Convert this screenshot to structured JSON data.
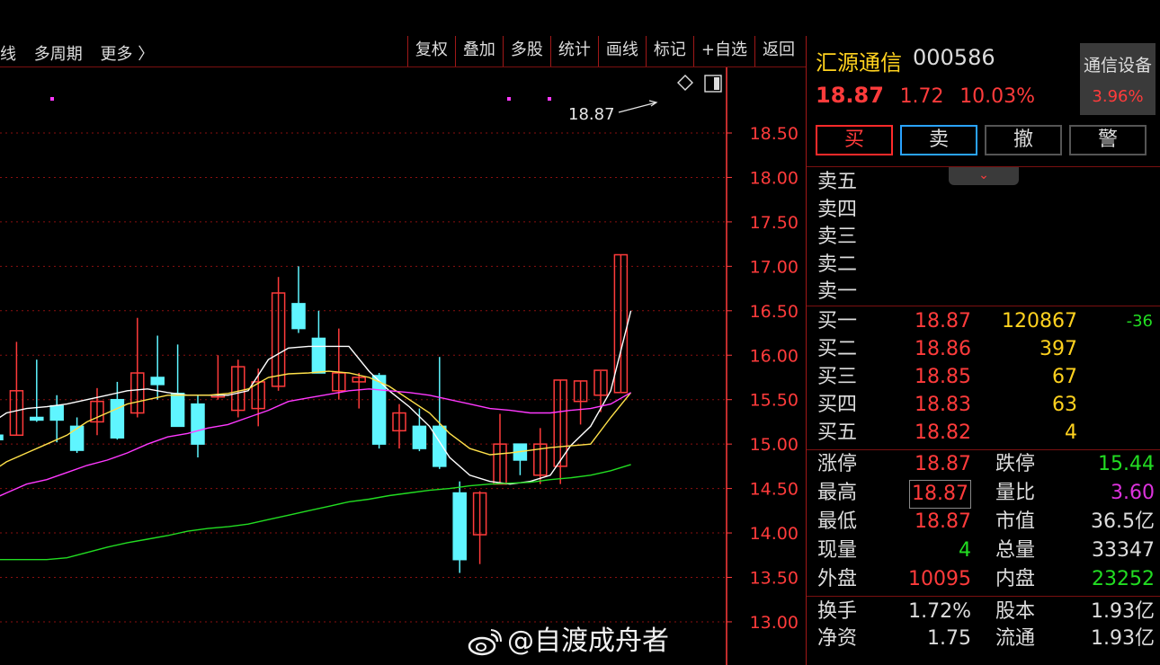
{
  "toolbar": {
    "left_items": [
      "线",
      "多周期",
      "更多 〉"
    ],
    "right_items": [
      "复权",
      "叠加",
      "多股",
      "统计",
      "画线",
      "标记",
      "+自选",
      "返回"
    ]
  },
  "chart_data": {
    "type": "candlestick",
    "y_ticks": [
      "18.50",
      "18.00",
      "17.50",
      "17.00",
      "16.50",
      "16.00",
      "15.50",
      "15.00",
      "14.50",
      "14.00",
      "13.50",
      "13.00"
    ],
    "ylim": [
      12.9,
      18.97
    ],
    "high_label": "18.87",
    "candles": [
      {
        "o": 15.1,
        "h": 15.25,
        "l": 14.8,
        "c": 15.05
      },
      {
        "o": 15.1,
        "h": 16.15,
        "l": 15.1,
        "c": 15.6
      },
      {
        "o": 15.3,
        "h": 15.95,
        "l": 15.25,
        "c": 15.27
      },
      {
        "o": 15.43,
        "h": 15.55,
        "l": 15.02,
        "c": 15.27
      },
      {
        "o": 15.2,
        "h": 15.3,
        "l": 14.9,
        "c": 14.93
      },
      {
        "o": 15.25,
        "h": 15.63,
        "l": 15.1,
        "c": 15.48
      },
      {
        "o": 15.5,
        "h": 15.7,
        "l": 15.05,
        "c": 15.07
      },
      {
        "o": 15.35,
        "h": 16.42,
        "l": 15.3,
        "c": 15.8
      },
      {
        "o": 15.75,
        "h": 16.22,
        "l": 15.5,
        "c": 15.67
      },
      {
        "o": 15.57,
        "h": 16.12,
        "l": 15.35,
        "c": 15.2
      },
      {
        "o": 15.45,
        "h": 15.55,
        "l": 14.85,
        "c": 15.0
      },
      {
        "o": 15.55,
        "h": 16.0,
        "l": 15.5,
        "c": 15.55
      },
      {
        "o": 15.38,
        "h": 15.95,
        "l": 15.3,
        "c": 15.87
      },
      {
        "o": 15.4,
        "h": 15.85,
        "l": 15.2,
        "c": 15.7
      },
      {
        "o": 15.65,
        "h": 16.88,
        "l": 15.6,
        "c": 16.7
      },
      {
        "o": 16.58,
        "h": 17.0,
        "l": 16.25,
        "c": 16.3
      },
      {
        "o": 16.19,
        "h": 16.5,
        "l": 15.8,
        "c": 15.8
      },
      {
        "o": 15.6,
        "h": 16.3,
        "l": 15.5,
        "c": 15.8
      },
      {
        "o": 15.7,
        "h": 15.8,
        "l": 15.4,
        "c": 15.75
      },
      {
        "o": 15.77,
        "h": 15.8,
        "l": 14.95,
        "c": 15.0
      },
      {
        "o": 15.15,
        "h": 15.45,
        "l": 14.95,
        "c": 15.35
      },
      {
        "o": 15.2,
        "h": 15.4,
        "l": 14.92,
        "c": 14.95
      },
      {
        "o": 15.2,
        "h": 15.98,
        "l": 14.72,
        "c": 14.75
      },
      {
        "o": 14.45,
        "h": 14.58,
        "l": 13.55,
        "c": 13.7
      },
      {
        "o": 13.98,
        "h": 14.47,
        "l": 13.65,
        "c": 14.45
      },
      {
        "o": 14.55,
        "h": 15.34,
        "l": 14.55,
        "c": 15.0
      },
      {
        "o": 15.0,
        "h": 15.0,
        "l": 14.65,
        "c": 14.82
      },
      {
        "o": 14.65,
        "h": 15.18,
        "l": 14.55,
        "c": 15.0
      },
      {
        "o": 14.75,
        "h": 15.72,
        "l": 14.55,
        "c": 15.72
      },
      {
        "o": 15.48,
        "h": 15.71,
        "l": 15.22,
        "c": 15.71
      },
      {
        "o": 15.55,
        "h": 15.82,
        "l": 15.36,
        "c": 15.83
      },
      {
        "o": 15.58,
        "h": 17.13,
        "l": 15.58,
        "c": 17.13
      }
    ],
    "ma_lines": [
      {
        "name": "MA5",
        "color": "#ffffff",
        "values": [
          15.2,
          15.35,
          15.4,
          15.42,
          15.45,
          15.5,
          15.55,
          15.6,
          15.62,
          15.58,
          15.55,
          15.55,
          15.55,
          15.6,
          15.95,
          16.08,
          16.1,
          16.1,
          16.1,
          15.82,
          15.6,
          15.42,
          15.2,
          14.85,
          14.65,
          14.58,
          14.55,
          14.58,
          14.65,
          14.98,
          15.2,
          15.6,
          16.5
        ]
      },
      {
        "name": "MA10",
        "color": "#ffe14a",
        "values": [
          14.65,
          14.8,
          14.9,
          15.0,
          15.1,
          15.25,
          15.35,
          15.45,
          15.5,
          15.55,
          15.55,
          15.55,
          15.57,
          15.62,
          15.75,
          15.79,
          15.8,
          15.82,
          15.8,
          15.75,
          15.65,
          15.5,
          15.35,
          15.12,
          14.95,
          14.88,
          14.9,
          14.93,
          14.96,
          14.98,
          15.0,
          15.3,
          15.58
        ]
      },
      {
        "name": "MA20",
        "color": "#ff39ff",
        "values": [
          14.35,
          14.45,
          14.55,
          14.6,
          14.68,
          14.76,
          14.82,
          14.9,
          15.0,
          15.08,
          15.12,
          15.18,
          15.22,
          15.3,
          15.38,
          15.48,
          15.52,
          15.56,
          15.6,
          15.62,
          15.6,
          15.58,
          15.55,
          15.5,
          15.45,
          15.4,
          15.38,
          15.35,
          15.35,
          15.38,
          15.4,
          15.45,
          15.58
        ]
      },
      {
        "name": "MA60",
        "color": "#22dd22",
        "values": [
          13.7,
          13.7,
          13.7,
          13.7,
          13.72,
          13.78,
          13.84,
          13.89,
          13.93,
          13.97,
          14.02,
          14.05,
          14.07,
          14.1,
          14.15,
          14.2,
          14.25,
          14.3,
          14.35,
          14.38,
          14.42,
          14.45,
          14.48,
          14.5,
          14.53,
          14.55,
          14.56,
          14.57,
          14.6,
          14.62,
          14.65,
          14.7,
          14.77
        ]
      }
    ]
  },
  "stock": {
    "name": "汇源通信",
    "code": "000586",
    "price": "18.87",
    "change": "1.72",
    "change_pct": "10.03%",
    "sector_name": "通信设备",
    "sector_pct": "3.96%"
  },
  "actions": {
    "buy": "买",
    "sell": "卖",
    "cancel": "撤",
    "alert": "警"
  },
  "collapse_label": "⌄",
  "asks": [
    {
      "label": "卖五"
    },
    {
      "label": "卖四"
    },
    {
      "label": "卖三"
    },
    {
      "label": "卖二"
    },
    {
      "label": "卖一"
    }
  ],
  "bids": [
    {
      "label": "买一",
      "price": "18.87",
      "vol": "120867",
      "delta": "-36"
    },
    {
      "label": "买二",
      "price": "18.86",
      "vol": "397",
      "delta": ""
    },
    {
      "label": "买三",
      "price": "18.85",
      "vol": "67",
      "delta": ""
    },
    {
      "label": "买四",
      "price": "18.83",
      "vol": "63",
      "delta": ""
    },
    {
      "label": "买五",
      "price": "18.82",
      "vol": "4",
      "delta": ""
    }
  ],
  "stats": [
    {
      "l1": "涨停",
      "v1": "18.87",
      "c1": "#ff3b3b",
      "l2": "跌停",
      "v2": "15.44",
      "c2": "#22dd22"
    },
    {
      "l1": "最高",
      "v1": "18.87",
      "c1": "#ff3b3b",
      "l2": "量比",
      "v2": "3.60",
      "c2": "#dd33dd"
    },
    {
      "l1": "最低",
      "v1": "18.87",
      "c1": "#ff3b3b",
      "l2": "市值",
      "v2": "36.5亿",
      "c2": "#dddddd"
    },
    {
      "l1": "现量",
      "v1": "4",
      "c1": "#22dd22",
      "l2": "总量",
      "v2": "33347",
      "c2": "#dddddd"
    },
    {
      "l1": "外盘",
      "v1": "10095",
      "c1": "#ff3b3b",
      "l2": "内盘",
      "v2": "23252",
      "c2": "#22dd22"
    }
  ],
  "stats2": [
    {
      "l1": "换手",
      "v1": "1.72%",
      "l2": "股本",
      "v2": "1.93亿"
    },
    {
      "l1": "净资",
      "v1": "1.75",
      "l2": "流通",
      "v2": "1.93亿"
    }
  ],
  "watermark": "@自渡成舟者",
  "colors": {
    "up": "#ff3b3b",
    "down": "#5ff5ff",
    "grid": "#8a1010",
    "axis": "#ff3b3b"
  }
}
